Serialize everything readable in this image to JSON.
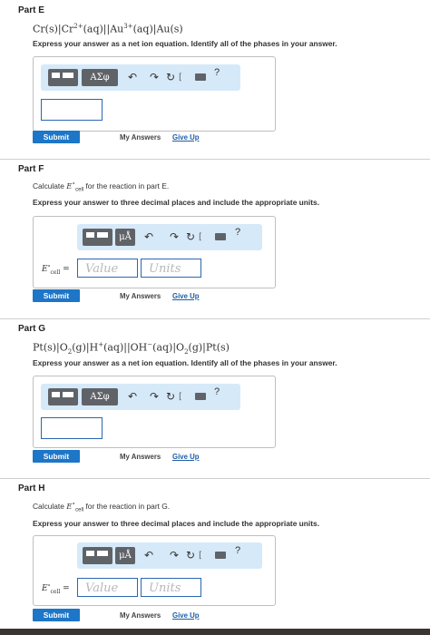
{
  "parts": {
    "E": {
      "title": "Part E",
      "instruction": "Express your answer as a net ion equation. Identify all of the phases in your answer.",
      "symbols_button": "ΑΣφ",
      "help": "?"
    },
    "F": {
      "title": "Part F",
      "desc_prefix": "Calculate",
      "desc_suffix": "for the reaction in part E.",
      "instruction": "Express your answer to three decimal places and include the appropriate units.",
      "units_button": "μÅ",
      "e_label": "E",
      "e_sub": "cell",
      "e_eq": " =",
      "value_placeholder": "Value",
      "units_placeholder": "Units",
      "help": "?"
    },
    "G": {
      "title": "Part G",
      "instruction": "Express your answer as a net ion equation. Identify all of the phases in your answer.",
      "symbols_button": "ΑΣφ",
      "help": "?"
    },
    "H": {
      "title": "Part H",
      "desc_prefix": "Calculate",
      "desc_suffix": "for the reaction in part G.",
      "instruction": "Express your answer to three decimal places and include the appropriate units.",
      "units_button": "μÅ",
      "e_label": "E",
      "e_sub": "cell",
      "e_eq": " =",
      "value_placeholder": "Value",
      "units_placeholder": "Units",
      "help": "?"
    }
  },
  "common": {
    "submit": "Submit",
    "my_answers": "My Answers",
    "give_up": "Give Up"
  },
  "icons": {
    "undo": "undo-icon",
    "redo": "redo-icon",
    "reset": "reset-icon",
    "keyboard": "keyboard-icon",
    "help": "help-icon"
  }
}
